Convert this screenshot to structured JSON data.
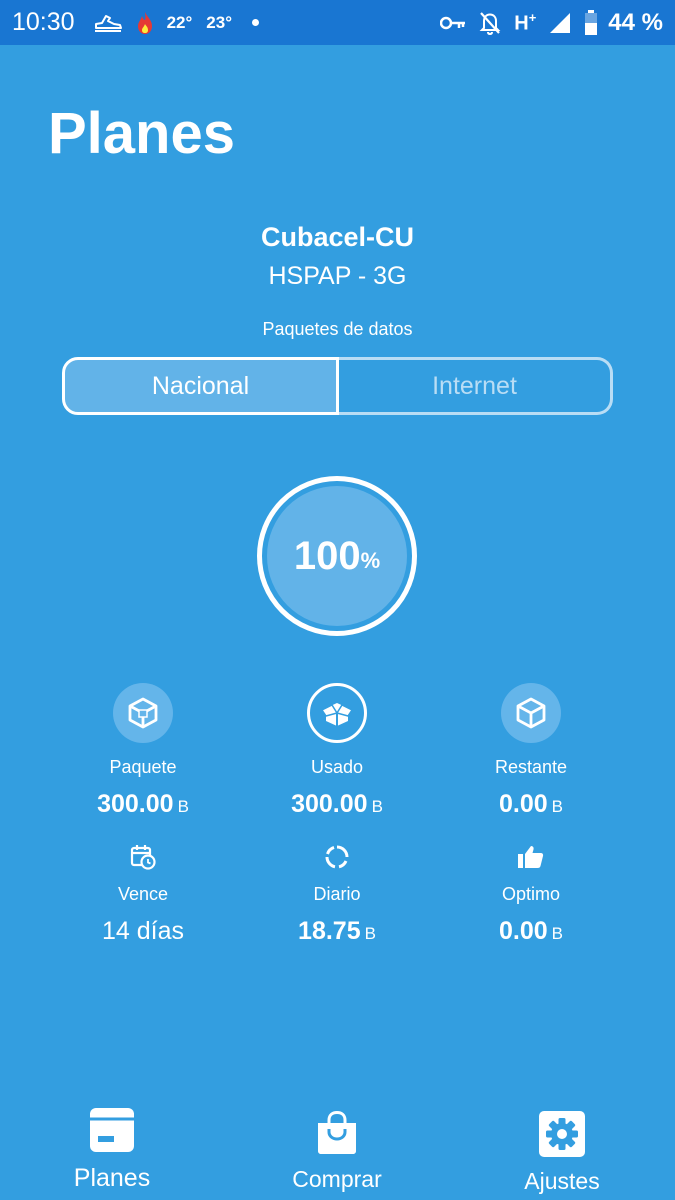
{
  "status_bar": {
    "time": "10:30",
    "temp_1": "22°",
    "temp_2": "23°",
    "network": "H",
    "network_sup": "+",
    "battery": "44 %"
  },
  "page": {
    "title": "Planes"
  },
  "network": {
    "name": "Cubacel-CU",
    "type": "HSPAP - 3G"
  },
  "packages": {
    "label": "Paquetes de datos",
    "tabs": [
      {
        "label": "Nacional",
        "selected": true
      },
      {
        "label": "Internet",
        "selected": false
      }
    ]
  },
  "usage": {
    "percent": "100",
    "percent_unit": "%"
  },
  "stats": {
    "package": {
      "label": "Paquete",
      "value": "300.00",
      "unit": "B"
    },
    "used": {
      "label": "Usado",
      "value": "300.00",
      "unit": "B"
    },
    "remaining": {
      "label": "Restante",
      "value": "0.00",
      "unit": "B"
    },
    "expires": {
      "label": "Vence",
      "value": "14 días"
    },
    "daily": {
      "label": "Diario",
      "value": "18.75",
      "unit": "B"
    },
    "optimal": {
      "label": "Optimo",
      "value": "0.00",
      "unit": "B"
    }
  },
  "bottom_nav": {
    "items": [
      {
        "label": "Planes",
        "icon": "plans-icon",
        "active": true
      },
      {
        "label": "Comprar",
        "icon": "shopping-bag-icon",
        "active": false
      },
      {
        "label": "Ajustes",
        "icon": "gear-icon",
        "active": false
      }
    ]
  },
  "colors": {
    "background": "#339ee0",
    "status_bar": "#1976d2",
    "accent_light": "#62b3e8",
    "text": "#ffffff"
  }
}
